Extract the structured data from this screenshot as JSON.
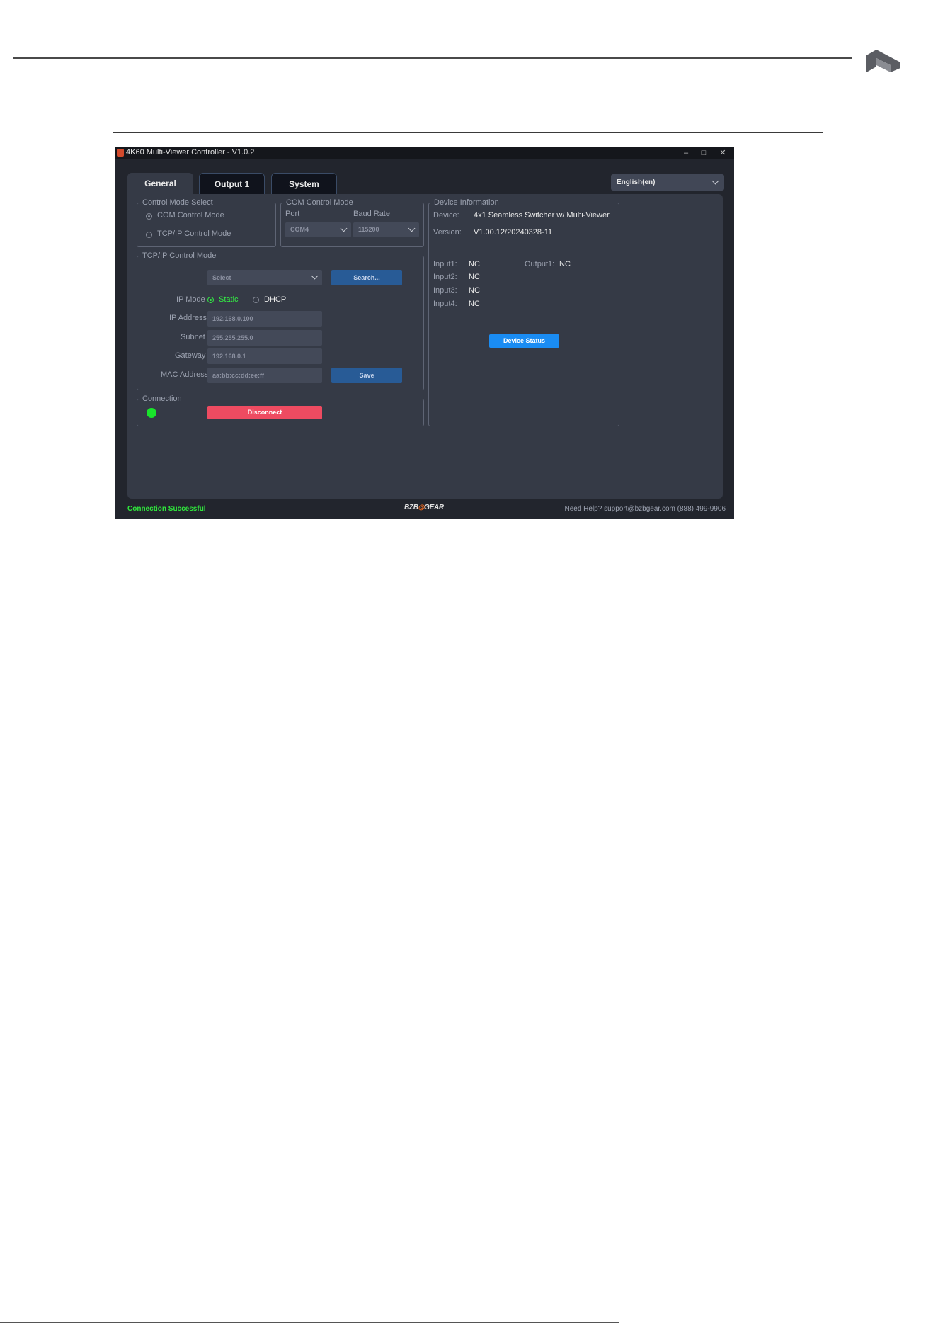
{
  "window": {
    "title": "4K60 Multi-Viewer Controller - V1.0.2",
    "controls": {
      "minimize": "–",
      "maximize": "□",
      "close": "✕"
    }
  },
  "tabs": [
    {
      "label": "General",
      "active": true
    },
    {
      "label": "Output 1",
      "active": false
    },
    {
      "label": "System",
      "active": false
    }
  ],
  "language": {
    "value": "English(en)"
  },
  "control_mode": {
    "title": "Control Mode Select",
    "options": [
      "COM Control Mode",
      "TCP/IP Control Mode"
    ],
    "selected": "COM Control Mode"
  },
  "com": {
    "title": "COM Control Mode",
    "port_label": "Port",
    "baud_label": "Baud Rate",
    "port_value": "COM4",
    "baud_value": "115200"
  },
  "tcpip": {
    "title": "TCP/IP Control Mode",
    "select_value": "Select",
    "search_label": "Search...",
    "ip_mode_label": "IP Mode",
    "ip_mode_options": [
      "Static",
      "DHCP"
    ],
    "ip_mode_selected": "Static",
    "ip_address_label": "IP Address",
    "ip_address_value": "192.168.0.100",
    "subnet_label": "Subnet",
    "subnet_value": "255.255.255.0",
    "gateway_label": "Gateway",
    "gateway_value": "192.168.0.1",
    "mac_label": "MAC Address",
    "mac_value": "aa:bb:cc:dd:ee:ff",
    "save_label": "Save"
  },
  "connection": {
    "title": "Connection",
    "disconnect_label": "Disconnect",
    "led_color": "#19e42b"
  },
  "device_info": {
    "title": "Device Information",
    "device_label": "Device:",
    "device_value": "4x1 Seamless Switcher w/ Multi-Viewer",
    "version_label": "Version:",
    "version_value": "V1.00.12/20240328-11",
    "inputs": [
      {
        "label": "Input1:",
        "value": "NC"
      },
      {
        "label": "Input2:",
        "value": "NC"
      },
      {
        "label": "Input3:",
        "value": "NC"
      },
      {
        "label": "Input4:",
        "value": "NC"
      }
    ],
    "output_label": "Output1:",
    "output_value": "NC",
    "status_button": "Device Status"
  },
  "footer": {
    "status": "Connection Successful",
    "brand_a": "BZB",
    "brand_b": "GEAR",
    "help": "Need Help? support@bzbgear.com (888) 499-9906"
  },
  "colors": {
    "accent_blue": "#1a8cf3",
    "disconnect_red": "#ee4b61",
    "success_green": "#2fe63c"
  }
}
